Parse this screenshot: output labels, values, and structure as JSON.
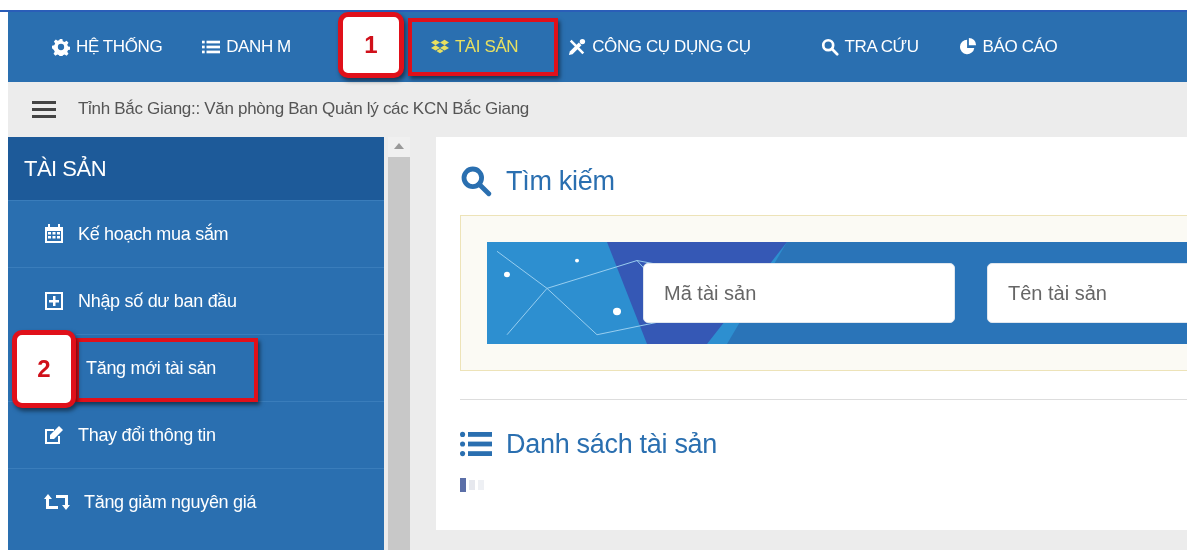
{
  "nav": [
    {
      "label": "HỆ THỐNG",
      "selected": false
    },
    {
      "label": "DANH M",
      "selected": false
    },
    {
      "label": "TÀI SẢN",
      "selected": true
    },
    {
      "label": "CÔNG CỤ DỤNG CỤ",
      "selected": false
    },
    {
      "label": "TRA CỨU",
      "selected": false
    },
    {
      "label": "BÁO CÁO",
      "selected": false
    }
  ],
  "breadcrumb": "Tỉnh Bắc Giang:: Văn phòng Ban Quản lý các KCN Bắc Giang",
  "sidebar": {
    "title": "TÀI SẢN",
    "items": [
      {
        "label": "Kế hoạch mua sắm"
      },
      {
        "label": "Nhập số dư ban đầu"
      },
      {
        "label": "Tăng mới tài sản"
      },
      {
        "label": "Thay đổi thông tin"
      },
      {
        "label": "Tăng giảm nguyên giá"
      }
    ]
  },
  "search": {
    "title": "Tìm kiếm",
    "fields": [
      {
        "placeholder": "Mã tài sản"
      },
      {
        "placeholder": "Tên tài sản"
      }
    ]
  },
  "list": {
    "title": "Danh sách tài sản"
  },
  "callouts": [
    {
      "label": "1"
    },
    {
      "label": "2"
    }
  ]
}
